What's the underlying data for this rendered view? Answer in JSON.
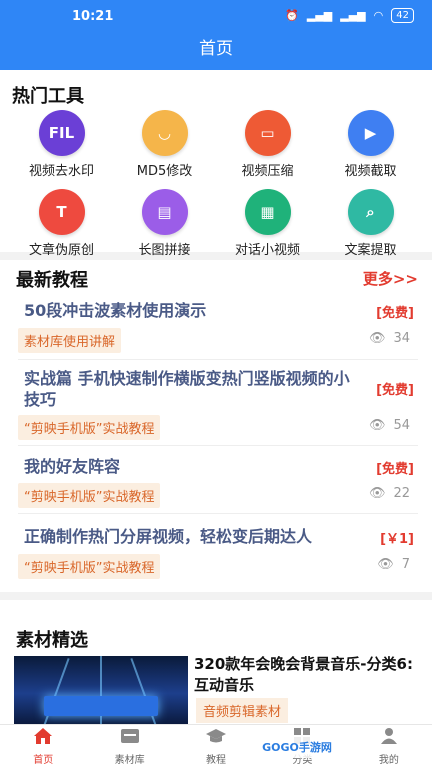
{
  "status": {
    "time": "10:21",
    "battery": "42"
  },
  "header": {
    "title": "首页"
  },
  "tools": {
    "title": "热门工具",
    "items": [
      {
        "label": "视频去水印",
        "glyph": "FIL",
        "color": "#6b3fd6",
        "icon": "watermark-removal-icon"
      },
      {
        "label": "MD5修改",
        "glyph": "◡",
        "color": "#f5b54a",
        "icon": "smile-icon"
      },
      {
        "label": "视频压缩",
        "glyph": "▭",
        "color": "#ee5a35",
        "icon": "compress-icon"
      },
      {
        "label": "视频截取",
        "glyph": "▶",
        "color": "#3f7ff2",
        "icon": "clip-icon"
      },
      {
        "label": "文章伪原创",
        "glyph": "T",
        "color": "#ee4a3f",
        "icon": "text-icon"
      },
      {
        "label": "长图拼接",
        "glyph": "▤",
        "color": "#9b5de8",
        "icon": "stitch-icon"
      },
      {
        "label": "对话小视频",
        "glyph": "▦",
        "color": "#1fb27a",
        "icon": "dialog-video-icon"
      },
      {
        "label": "文案提取",
        "glyph": "⌕",
        "color": "#2fb9a3",
        "icon": "extract-icon"
      }
    ]
  },
  "tutorials": {
    "title": "最新教程",
    "more": "更多>>",
    "items": [
      {
        "title": "50段冲击波素材使用演示",
        "price": "[免费]",
        "tag": "素材库使用讲解",
        "views": "34"
      },
      {
        "title": "实战篇 手机快速制作横版变热门竖版视频的小技巧",
        "price": "[免费]",
        "tag": "“剪映手机版”实战教程",
        "views": "54"
      },
      {
        "title": "我的好友阵容",
        "price": "[免费]",
        "tag": "“剪映手机版”实战教程",
        "views": "22"
      },
      {
        "title": "正确制作热门分屏视频，轻松变后期达人",
        "price": "[￥1]",
        "tag": "“剪映手机版”实战教程",
        "views": "7"
      }
    ]
  },
  "materials": {
    "title": "素材精选",
    "item": {
      "title": "320款年会晚会背景音乐-分类6: 互动音乐",
      "tag": "音频剪辑素材"
    }
  },
  "tabbar": {
    "items": [
      {
        "label": "首页",
        "icon": "home-icon",
        "active": true
      },
      {
        "label": "素材库",
        "icon": "archive-icon"
      },
      {
        "label": "教程",
        "icon": "graduation-cap-icon"
      },
      {
        "label": "分类",
        "icon": "category-icon"
      },
      {
        "label": "我的",
        "icon": "user-icon"
      }
    ]
  },
  "watermark": "GOGO手游网"
}
